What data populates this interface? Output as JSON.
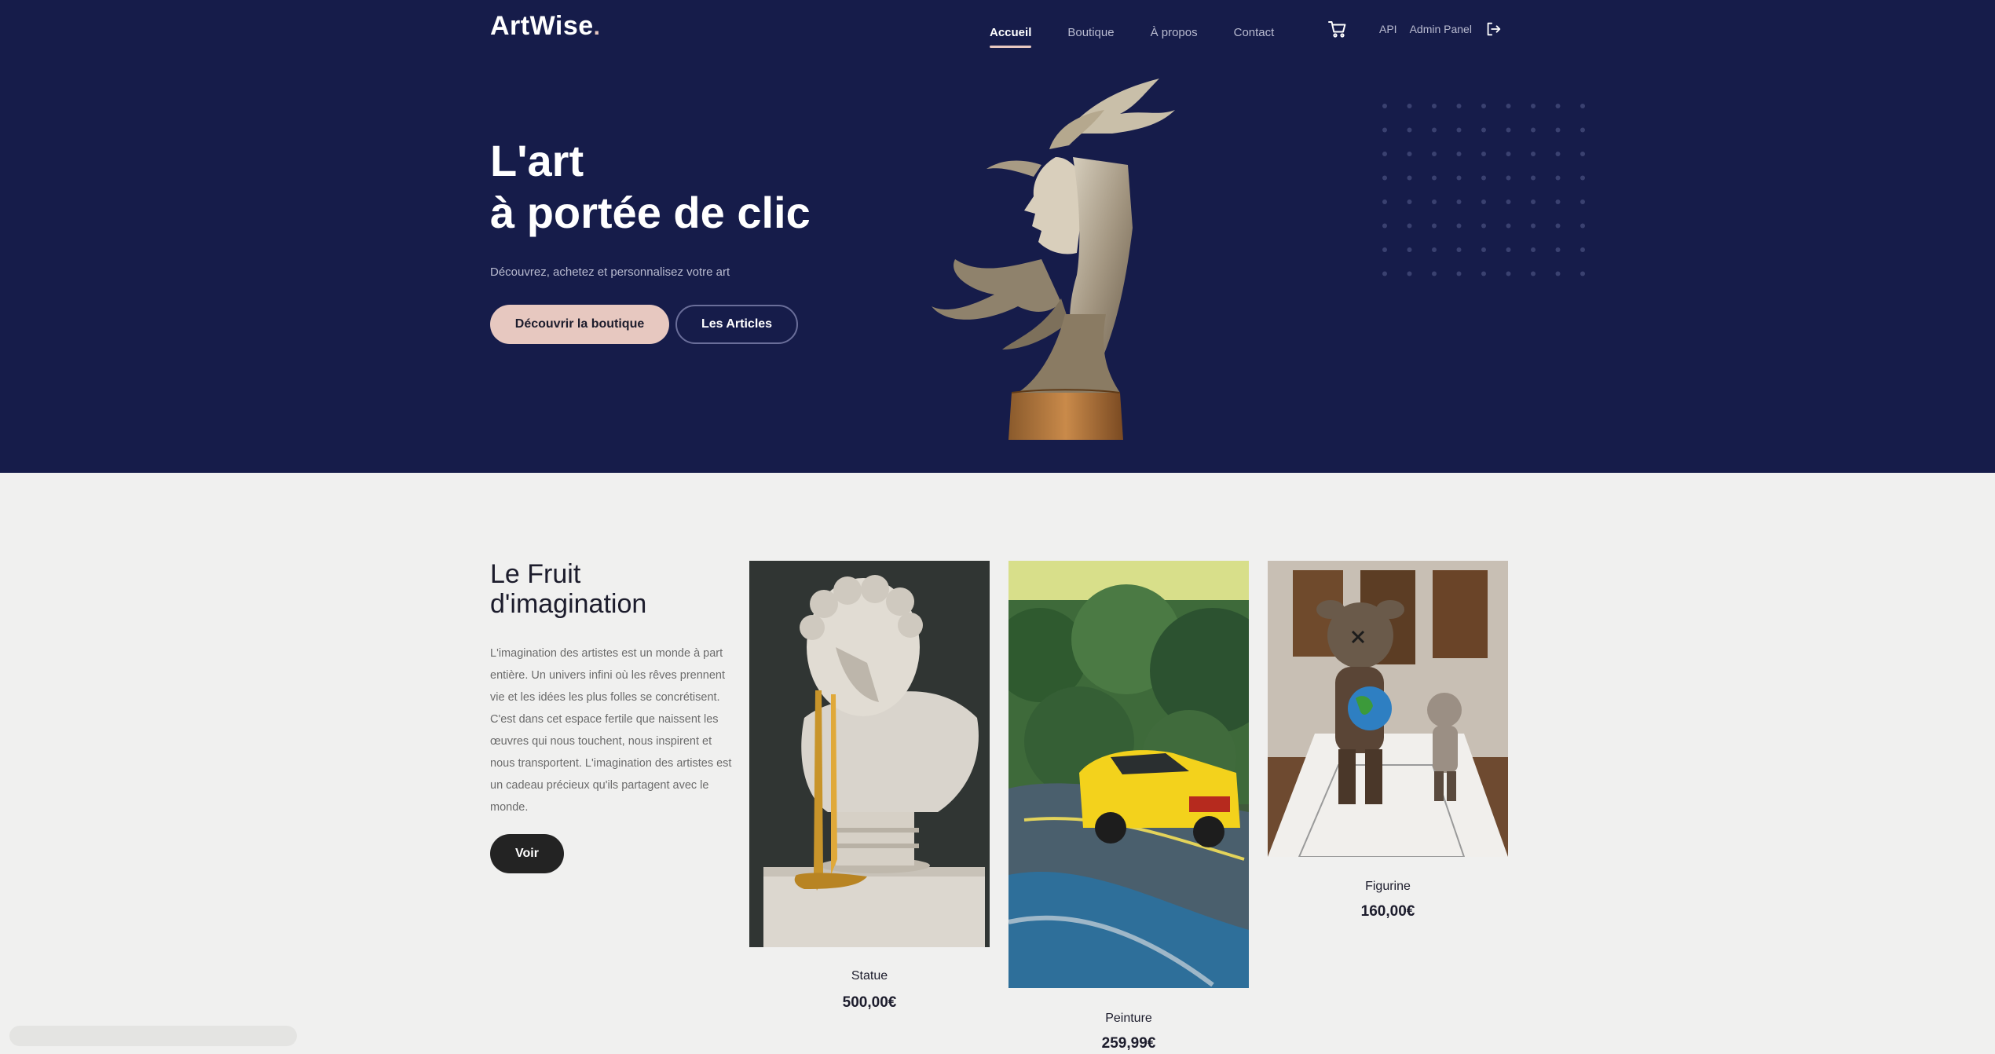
{
  "brand": {
    "name": "ArtWise",
    "dot": "."
  },
  "nav": {
    "links": [
      {
        "label": "Accueil",
        "active": true
      },
      {
        "label": "Boutique",
        "active": false
      },
      {
        "label": "À propos",
        "active": false
      },
      {
        "label": "Contact",
        "active": false
      }
    ],
    "api_label": "API",
    "admin_label": "Admin Panel",
    "icons": [
      "cart-icon",
      "logout-icon"
    ]
  },
  "hero": {
    "title_line1": "L'art",
    "title_line2": "à portée de clic",
    "subtitle": "Découvrez, achetez et personnalisez votre art",
    "primary_button": "Découvrir la boutique",
    "secondary_button": "Les Articles"
  },
  "feature": {
    "title_line1": "Le Fruit",
    "title_line2": "d'imagination",
    "text": "L'imagination des artistes est un monde à part entière. Un univers infini où les rêves prennent vie et les idées les plus folles se concrétisent. C'est dans cet espace fertile que naissent les œuvres qui nous touchent, nous inspirent et nous transportent. L'imagination des artistes est un cadeau précieux qu'ils partagent avec le monde.",
    "button": "Voir"
  },
  "products": [
    {
      "name": "Statue",
      "price": "500,00€"
    },
    {
      "name": "Peinture",
      "price": "259,99€"
    },
    {
      "name": "Figurine",
      "price": "160,00€"
    }
  ],
  "colors": {
    "hero_bg": "#161c4a",
    "accent": "#e7c8c0",
    "page_bg": "#f0f0ef",
    "dark_button": "#232323"
  }
}
